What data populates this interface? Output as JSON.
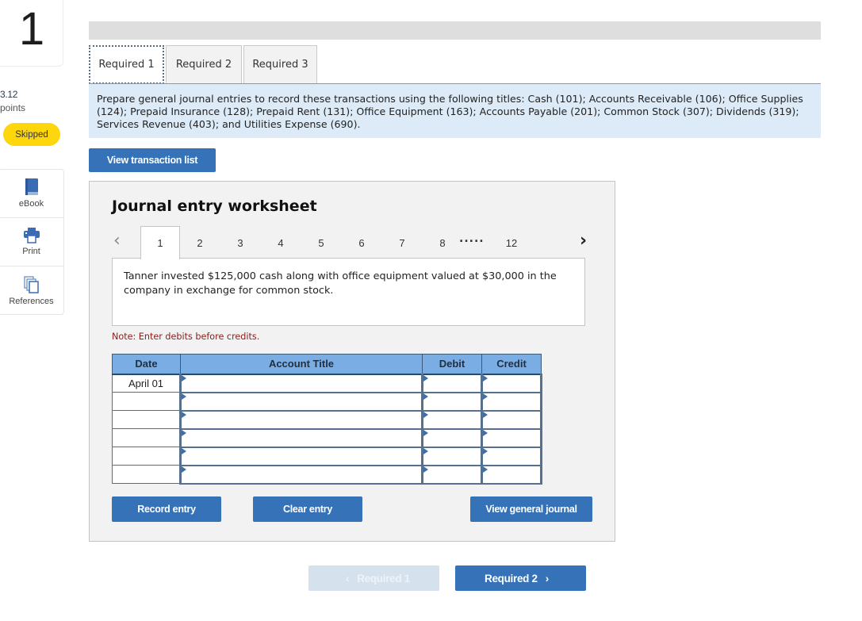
{
  "question": {
    "number": "1",
    "points_value": "3.12",
    "points_label": "points",
    "status": "Skipped"
  },
  "tools": [
    {
      "label": "eBook",
      "icon": "book-icon"
    },
    {
      "label": "Print",
      "icon": "printer-icon"
    },
    {
      "label": "References",
      "icon": "copy-pages-icon"
    }
  ],
  "tabs": [
    {
      "label": "Required 1",
      "active": true
    },
    {
      "label": "Required 2",
      "active": false
    },
    {
      "label": "Required 3",
      "active": false
    }
  ],
  "instructions": "Prepare general journal entries to record these transactions using the following titles: Cash (101); Accounts Receivable (106); Office Supplies (124); Prepaid Insurance (128); Prepaid Rent (131); Office Equipment (163); Accounts Payable (201); Common Stock (307); Dividends (319); Services Revenue (403); and Utilities Expense (690).",
  "view_transaction_list_label": "View transaction list",
  "worksheet": {
    "title": "Journal entry worksheet",
    "pager": {
      "prev_icon": "‹",
      "next_icon": "›",
      "pages": [
        "1",
        "2",
        "3",
        "4",
        "5",
        "6",
        "7",
        "8"
      ],
      "ellipsis": ".....",
      "last_page": "12",
      "active_page": "1"
    },
    "transaction": "Tanner invested $125,000 cash along with office equipment valued at $30,000 in the company in exchange for common stock.",
    "note": "Note: Enter debits before credits.",
    "table": {
      "headers": {
        "date": "Date",
        "account": "Account Title",
        "debit": "Debit",
        "credit": "Credit"
      },
      "rows": [
        {
          "date": "April 01",
          "account": "",
          "debit": "",
          "credit": ""
        },
        {
          "date": "",
          "account": "",
          "debit": "",
          "credit": ""
        },
        {
          "date": "",
          "account": "",
          "debit": "",
          "credit": ""
        },
        {
          "date": "",
          "account": "",
          "debit": "",
          "credit": ""
        },
        {
          "date": "",
          "account": "",
          "debit": "",
          "credit": ""
        },
        {
          "date": "",
          "account": "",
          "debit": "",
          "credit": ""
        }
      ]
    },
    "buttons": {
      "record": "Record entry",
      "clear": "Clear entry",
      "view_journal": "View general journal"
    }
  },
  "bottom_nav": {
    "prev_label": "Required 1",
    "prev_icon": "‹",
    "next_label": "Required 2",
    "next_icon": "›"
  },
  "colors": {
    "accent": "#3572b8",
    "skipped_badge": "#fdd60b",
    "table_header": "#7aade3",
    "instructions_bg": "#dcebf7",
    "note_text": "#8a1c1c"
  }
}
